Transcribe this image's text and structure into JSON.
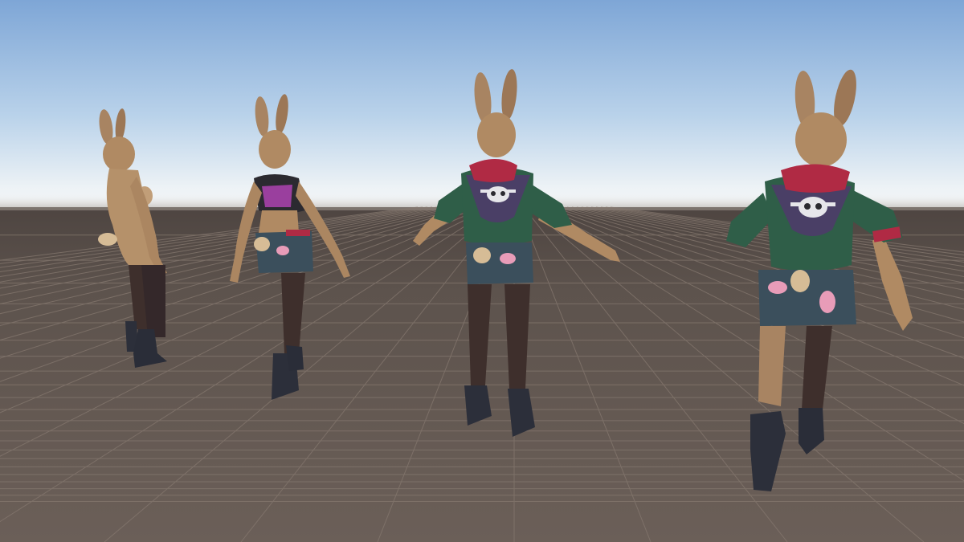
{
  "scene": {
    "type": "3d-viewport",
    "colors": {
      "sky_top": "#7ea6d6",
      "sky_mid": "#b9d2ea",
      "horizon_glow": "#eef3f6",
      "ground_near": "#6a5e57",
      "ground_far": "#554b46",
      "grid_line": "#8a7e77",
      "fur": "#b08a63",
      "fur_dark": "#7e5c3e",
      "jacket_green": "#2f5e48",
      "jacket_panel": "#4a3f66",
      "hood_red": "#b02a44",
      "shorts": "#3b4f5c",
      "stocking": "#3e2f2c",
      "boot": "#2c2f3a",
      "top_purple": "#9a3f9e"
    },
    "characters": [
      {
        "name": "bunny-figure-1",
        "variant": "bare",
        "pose": "side-stand"
      },
      {
        "name": "bunny-figure-2",
        "variant": "crop-top-shorts",
        "pose": "back-stand"
      },
      {
        "name": "bunny-figure-3",
        "variant": "jacket-shorts",
        "pose": "back-t-pose"
      },
      {
        "name": "bunny-figure-4",
        "variant": "jacket-shorts",
        "pose": "back-run"
      }
    ]
  }
}
